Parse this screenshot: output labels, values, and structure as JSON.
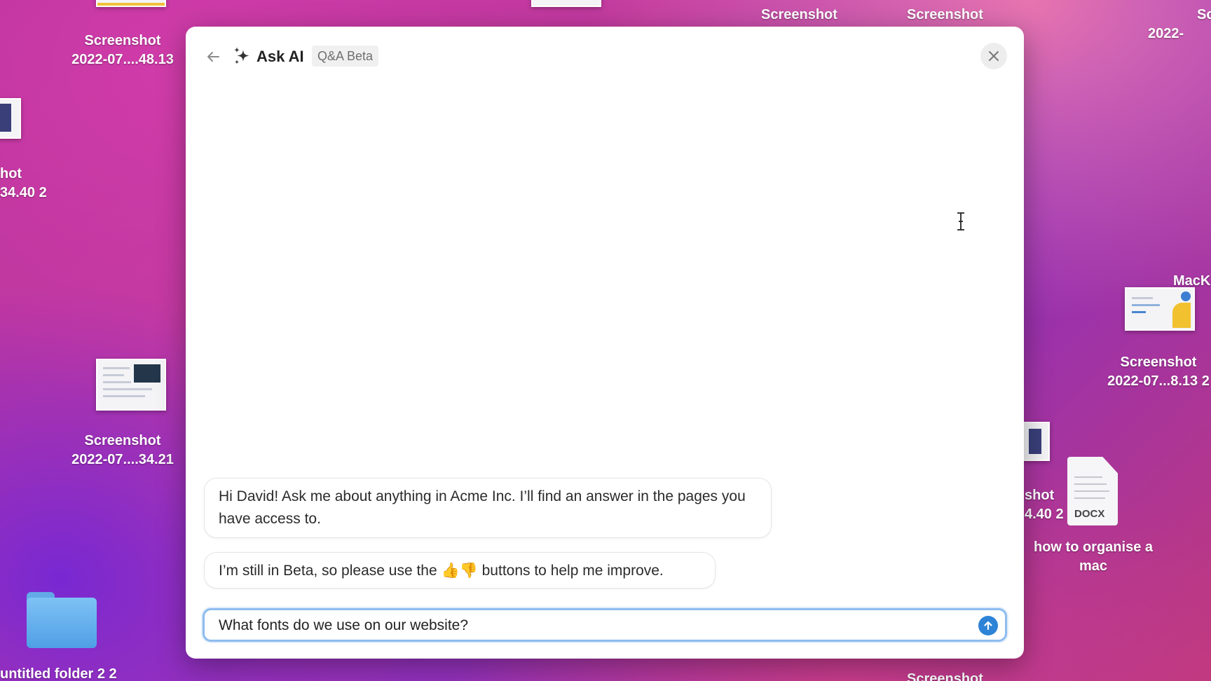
{
  "desktop": {
    "items": [
      {
        "label_lines": [
          "Screenshot",
          "2022-07....48.13"
        ]
      },
      {
        "label_lines": [
          "hot",
          "34.40 2"
        ]
      },
      {
        "label_lines": [
          "Screenshot",
          "2022-07....34.21"
        ]
      },
      {
        "label_lines": [
          "untitled folder 2 2"
        ]
      },
      {
        "label_lines": [
          "Screenshot"
        ]
      },
      {
        "label_lines": [
          "Screenshot"
        ]
      },
      {
        "label_lines": [
          "Sc",
          "2022-"
        ]
      },
      {
        "label_lines": [
          "MacK"
        ]
      },
      {
        "label_lines": [
          "Screenshot",
          "2022-07...8.13 2"
        ]
      },
      {
        "label_lines": [
          "shot",
          "4.40 2"
        ]
      },
      {
        "label_lines": [
          "how to organise a",
          "mac"
        ]
      },
      {
        "label_lines": [
          "Screenshot"
        ]
      }
    ],
    "docx_tag": "DOCX"
  },
  "modal": {
    "title": "Ask AI",
    "badge": "Q&A Beta",
    "icons": {
      "back": "arrow-left-icon",
      "sparkle": "sparkle-icon",
      "close": "close-icon",
      "send": "arrow-up-icon"
    },
    "messages": [
      {
        "text": "Hi David! Ask me about anything in Acme Inc. I’ll find an answer in the pages you have access to."
      },
      {
        "text": "I’m still in Beta, so please use the 👍👎 buttons to help me improve."
      }
    ],
    "input": {
      "value": "What fonts do we use on our website?"
    },
    "accent_color": "#2d83d6"
  }
}
